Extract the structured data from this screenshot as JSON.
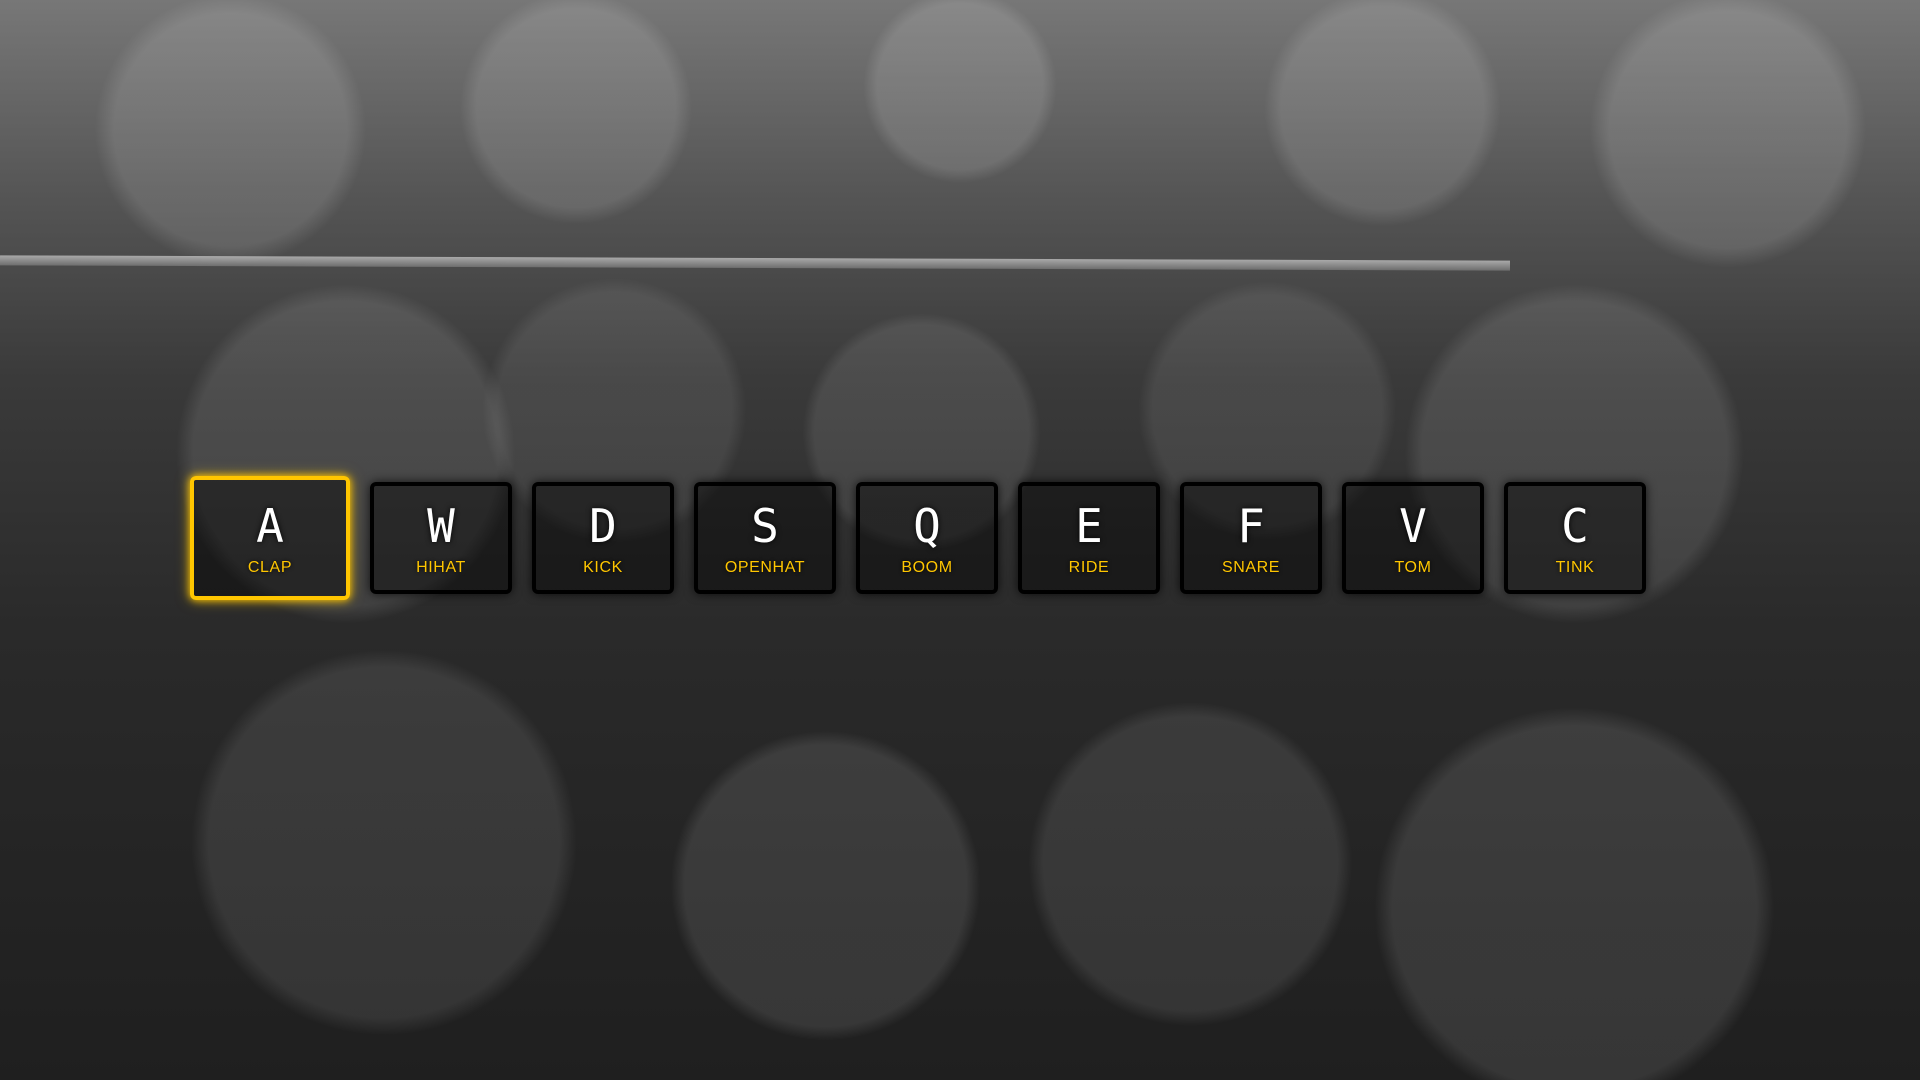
{
  "accent": "#ffc600",
  "background": {
    "description_icon": "crowd-photo"
  },
  "keys": [
    {
      "key": "A",
      "sound": "CLAP",
      "playing": true
    },
    {
      "key": "W",
      "sound": "HIHAT",
      "playing": false
    },
    {
      "key": "D",
      "sound": "KICK",
      "playing": false
    },
    {
      "key": "S",
      "sound": "OPENHAT",
      "playing": false
    },
    {
      "key": "Q",
      "sound": "BOOM",
      "playing": false
    },
    {
      "key": "E",
      "sound": "RIDE",
      "playing": false
    },
    {
      "key": "F",
      "sound": "SNARE",
      "playing": false
    },
    {
      "key": "V",
      "sound": "TOM",
      "playing": false
    },
    {
      "key": "C",
      "sound": "TINK",
      "playing": false
    }
  ]
}
